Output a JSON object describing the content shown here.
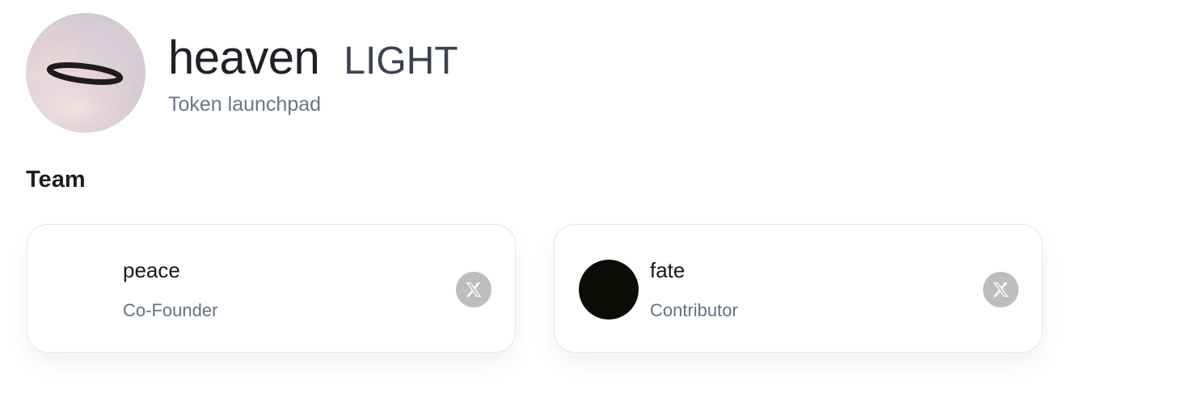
{
  "project": {
    "name": "heaven",
    "tag": "LIGHT",
    "subtitle": "Token launchpad",
    "logo_icon": "halo-icon"
  },
  "team": {
    "title": "Team",
    "members": [
      {
        "name": "peace",
        "role": "Co-Founder",
        "avatar": "none",
        "social_icon": "x-logo-icon"
      },
      {
        "name": "fate",
        "role": "Contributor",
        "avatar": "black-circle",
        "social_icon": "x-logo-icon"
      }
    ]
  },
  "colors": {
    "title": "#1f2128",
    "subtitle": "#6b7585",
    "card_border": "#e5e7eb",
    "social_button": "#bdbdbd"
  }
}
